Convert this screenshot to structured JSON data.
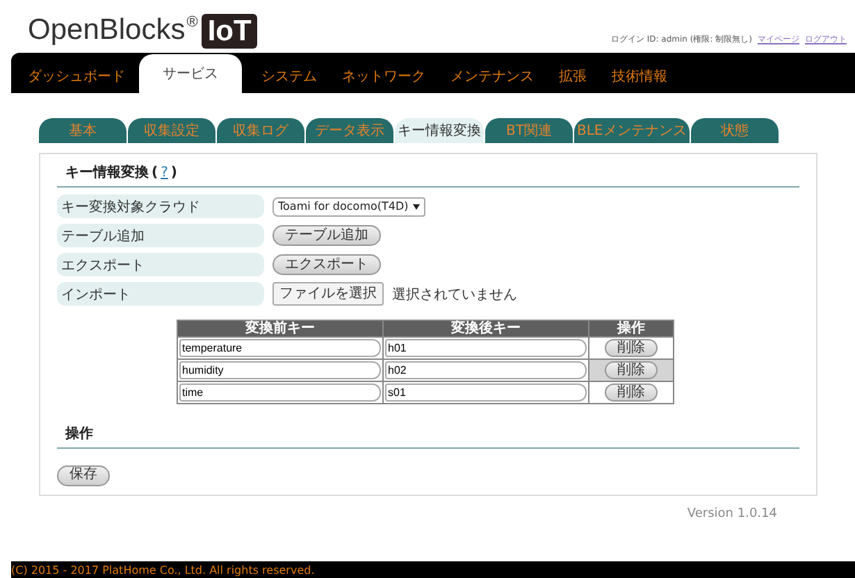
{
  "logo": {
    "name": "OpenBlocks",
    "mark": "®",
    "badge": "IoT"
  },
  "login": {
    "text": "ログイン ID: admin (権限: 制限無し)",
    "links": [
      "マイページ",
      "ログアウト"
    ]
  },
  "nav": [
    {
      "label": "ダッシュボード",
      "selected": false
    },
    {
      "label": "サービス",
      "selected": true
    },
    {
      "label": "システム",
      "selected": false
    },
    {
      "label": "ネットワーク",
      "selected": false
    },
    {
      "label": "メンテナンス",
      "selected": false
    },
    {
      "label": "拡張",
      "selected": false
    },
    {
      "label": "技術情報",
      "selected": false
    }
  ],
  "tabs": [
    {
      "label": "基本",
      "selected": false
    },
    {
      "label": "収集設定",
      "selected": false
    },
    {
      "label": "収集ログ",
      "selected": false
    },
    {
      "label": "データ表示",
      "selected": false
    },
    {
      "label": "キー情報変換",
      "selected": true
    },
    {
      "label": "BT関連",
      "selected": false
    },
    {
      "label": "BLEメンテナンス",
      "selected": false
    },
    {
      "label": "状態",
      "selected": false
    }
  ],
  "section": {
    "title": "キー情報変換",
    "help": {
      "open": "(",
      "link": "?",
      "close": ")"
    }
  },
  "settings": [
    {
      "label": "キー変換対象クラウド",
      "kind": "select",
      "value": "Toami for docomo(T4D)"
    },
    {
      "label": "テーブル追加",
      "kind": "button",
      "value": "テーブル追加"
    },
    {
      "label": "エクスポート",
      "kind": "button",
      "value": "エクスポート"
    },
    {
      "label": "インポート",
      "kind": "file",
      "value": "ファイルを選択",
      "note": "選択されていません"
    }
  ],
  "table": {
    "columns": [
      "変換前キー",
      "変換後キー",
      "操作"
    ],
    "rows": [
      {
        "before": "temperature",
        "after": "h01",
        "action": "削除",
        "highlighted": false
      },
      {
        "before": "humidity",
        "after": "h02",
        "action": "削除",
        "highlighted": true
      },
      {
        "before": "time",
        "after": "s01",
        "action": "削除",
        "highlighted": false
      }
    ]
  },
  "operation": {
    "title": "操作",
    "button": "保存"
  },
  "version": "Version 1.0.14",
  "footer": "(C) 2015 - 2017 PlatHome Co., Ltd. All rights reserved."
}
